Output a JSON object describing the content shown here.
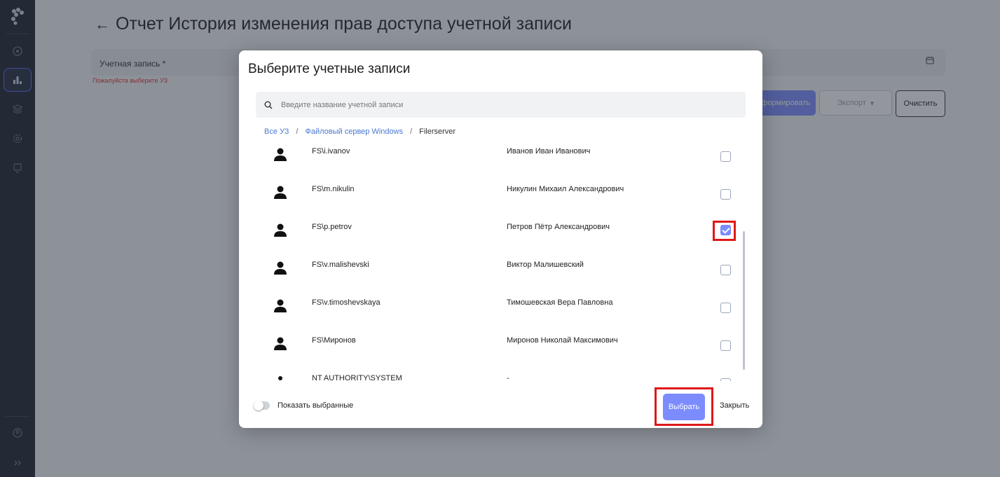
{
  "page": {
    "title": "Отчет История изменения прав доступа учетной записи",
    "back_arrow": "←",
    "account_field_label": "Учетная запись *",
    "account_field_error": "Пожалуйста выберите УЗ",
    "form_button": "формировать",
    "export_button": "Экспорт",
    "clear_button": "Очистить"
  },
  "modal": {
    "title": "Выберите учетные записи",
    "search_placeholder": "Введите название учетной записи",
    "breadcrumb": {
      "root": "Все УЗ",
      "sep1": "/",
      "middle": "Файловый сервер Windows",
      "sep2": "/",
      "current": "Filerserver"
    },
    "rows": [
      {
        "login": "FS\\i.ivanov",
        "fullname": "Иванов Иван Иванович",
        "checked": false
      },
      {
        "login": "FS\\m.nikulin",
        "fullname": "Никулин Михаил Александрович",
        "checked": false
      },
      {
        "login": "FS\\p.petrov",
        "fullname": "Петров Пётр Александрович",
        "checked": true
      },
      {
        "login": "FS\\v.malishevski",
        "fullname": "Виктор Малишевский",
        "checked": false
      },
      {
        "login": "FS\\v.timoshevskaya",
        "fullname": "Тимошевская Вера Павловна",
        "checked": false
      },
      {
        "login": "FS\\Миронов",
        "fullname": "Миронов Николай Максимович",
        "checked": false
      },
      {
        "login": "NT AUTHORITY\\SYSTEM",
        "fullname": "-",
        "checked": false
      }
    ],
    "show_selected_label": "Показать выбранные",
    "select_button": "Выбрать",
    "close_button": "Закрыть"
  },
  "colors": {
    "accent": "#7c8cff",
    "highlight": "#e01818",
    "rail": "#1f2430"
  }
}
